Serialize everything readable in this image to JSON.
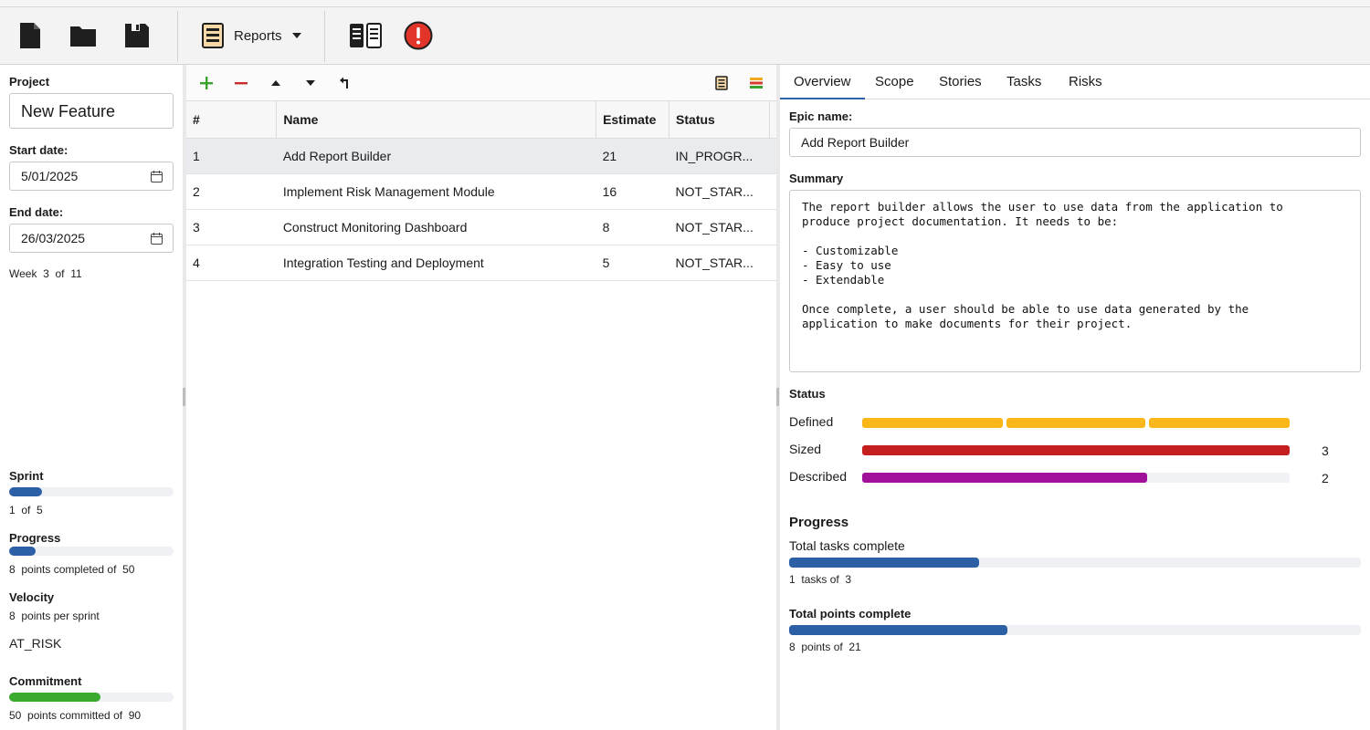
{
  "toolbar": {
    "icons": [
      "new-file-icon",
      "open-folder-icon",
      "save-icon",
      "reports-icon",
      "layout-icon",
      "alert-icon"
    ],
    "reports_label": "Reports"
  },
  "left": {
    "project_label": "Project",
    "project_value": "New Feature",
    "start_label": "Start date:",
    "start_value": "5/01/2025",
    "end_label": "End date:",
    "end_value": "26/03/2025",
    "week_word": "Week",
    "week_current": "3",
    "week_of": "of",
    "week_total": "11",
    "sprint_label": "Sprint",
    "sprint_current": "1",
    "sprint_of": "of",
    "sprint_total": "5",
    "sprint_fraction": 0.2,
    "progress_label": "Progress",
    "progress_points": "8",
    "progress_text": "points completed of",
    "progress_total": "50",
    "progress_fraction": 0.16,
    "velocity_label": "Velocity",
    "velocity_points": "8",
    "velocity_text": "points per sprint",
    "risk_status": "AT_RISK",
    "commitment_label": "Commitment",
    "commitment_points": "50",
    "commitment_text": "points committed of",
    "commitment_total": "90",
    "commitment_fraction": 0.556,
    "commitment_color": "#3aaa2e"
  },
  "center": {
    "tool_icons": [
      "add-icon",
      "remove-icon",
      "move-up-icon",
      "move-down-icon",
      "outdent-icon",
      "report-icon",
      "color-bars-icon"
    ],
    "columns": [
      "#",
      "Name",
      "Estimate",
      "Status"
    ],
    "rows": [
      {
        "num": "1",
        "name": "Add Report Builder",
        "estimate": "21",
        "status": "IN_PROGR..."
      },
      {
        "num": "2",
        "name": "Implement Risk Management Module",
        "estimate": "16",
        "status": "NOT_STAR..."
      },
      {
        "num": "3",
        "name": "Construct Monitoring Dashboard",
        "estimate": "8",
        "status": "NOT_STAR..."
      },
      {
        "num": "4",
        "name": "Integration Testing and Deployment",
        "estimate": "5",
        "status": "NOT_STAR..."
      }
    ]
  },
  "right": {
    "tabs": [
      "Overview",
      "Scope",
      "Stories",
      "Tasks",
      "Risks"
    ],
    "epic_label": "Epic name:",
    "epic_value": "Add Report Builder",
    "summary_label": "Summary",
    "summary_text": "The report builder allows the user to use data from the application to\nproduce project documentation. It needs to be:\n\n- Customizable\n- Easy to use\n- Extendable\n\nOnce complete, a user should be able to use data generated by the\napplication to make documents for their project.",
    "status_label": "Status",
    "status": {
      "defined_label": "Defined",
      "defined_color": "#fbb717",
      "sized_label": "Sized",
      "sized_count": "3",
      "sized_color": "#c41e1e",
      "sized_fraction": 1.0,
      "described_label": "Described",
      "described_count": "2",
      "described_color": "#a0109a",
      "described_fraction": 0.667
    },
    "progress_label": "Progress",
    "tasks_label": "Total tasks complete",
    "tasks_done": "1",
    "tasks_text": "tasks of",
    "tasks_total": "3",
    "tasks_fraction": 0.333,
    "points_label": "Total points complete",
    "points_done": "8",
    "points_text": "points of",
    "points_total": "21",
    "points_fraction": 0.381,
    "bar_color": "#2d5fa6"
  }
}
